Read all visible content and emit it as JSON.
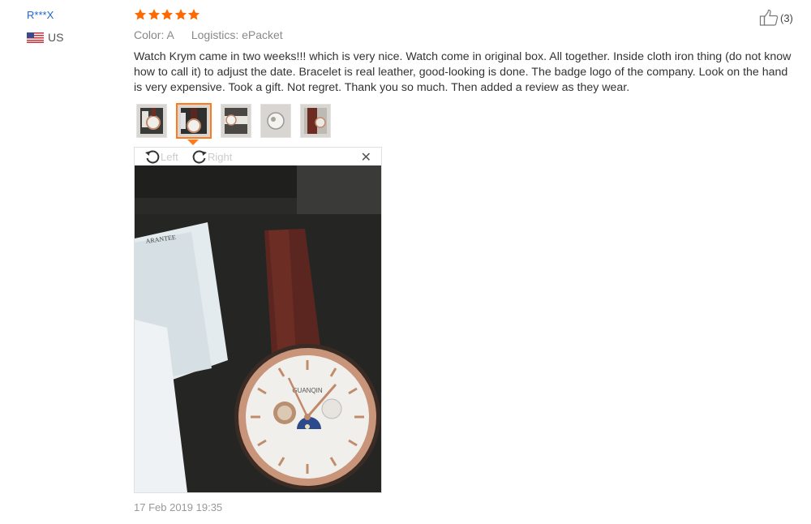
{
  "reviewer": {
    "name": "R***X",
    "country": "US",
    "flag_icon": "us-flag-icon"
  },
  "rating": {
    "stars": 5,
    "max": 5,
    "color": "#ff6a00"
  },
  "meta": {
    "color_label": "Color:",
    "color_value": "A",
    "logistics_label": "Logistics:",
    "logistics_value": "ePacket"
  },
  "helpful": {
    "icon": "thumbs-up-icon",
    "count": "(3)"
  },
  "review_text": "Watch Krym came in two weeks!!! which is very nice. Watch come in original box. All together. Inside cloth iron thing (do not know how to call it) to adjust the date. Bracelet is real leather, good-looking is done. The badge logo of the company. Look on the hand is very expensive. Took a gift. Not regret. Thank you so much. Then added a review as they wear.",
  "thumbnails": [
    {
      "icon": "watch-photo-thumbnail",
      "active": false
    },
    {
      "icon": "watch-photo-thumbnail",
      "active": true
    },
    {
      "icon": "watch-photo-thumbnail",
      "active": false
    },
    {
      "icon": "watch-photo-thumbnail",
      "active": false
    },
    {
      "icon": "watch-photo-thumbnail",
      "active": false
    }
  ],
  "viewer": {
    "rotate_left_label": "Left",
    "rotate_right_label": "Right",
    "close_icon": "close-icon",
    "photo_watch_brand": "GUANQIN",
    "photo_card_text": "ARANTEE"
  },
  "date": "17 Feb 2019 19:35"
}
